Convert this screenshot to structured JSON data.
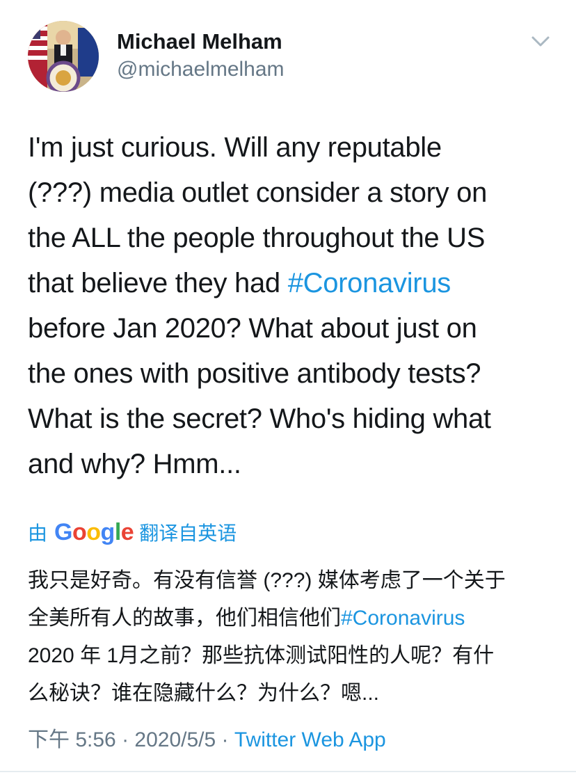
{
  "author": {
    "display_name": "Michael Melham",
    "handle": "@michaelmelham",
    "avatar_icon": "profile-photo-with-township-seal"
  },
  "menu": {
    "icon": "chevron-down-icon"
  },
  "tweet": {
    "lines": [
      {
        "text": "I'm just curious.  Will any reputable",
        "hashtag": ""
      },
      {
        "text": "(???) media outlet consider a story on",
        "hashtag": ""
      },
      {
        "text": "the ALL the people throughout the US",
        "hashtag": ""
      },
      {
        "text": "that believe they had ",
        "hashtag": "#Coronavirus"
      },
      {
        "text": "before Jan 2020? What about just on",
        "hashtag": ""
      },
      {
        "text": "the ones with positive antibody tests?",
        "hashtag": ""
      },
      {
        "text": "What is the secret? Who's hiding what",
        "hashtag": ""
      },
      {
        "text": "and why? Hmm...",
        "hashtag": ""
      }
    ]
  },
  "translation": {
    "prefix": "由",
    "google": [
      "G",
      "o",
      "o",
      "g",
      "l",
      "e"
    ],
    "suffix": "翻译自英语",
    "lines": [
      {
        "text": "我只是好奇。有没有信誉 (???) 媒体考虑了一个关于",
        "hashtag": ""
      },
      {
        "text": "全美所有人的故事，他们相信他们",
        "hashtag": "#Coronavirus"
      },
      {
        "text": "2020 年 1月之前？那些抗体测试阳性的人呢？有什",
        "hashtag": ""
      },
      {
        "text": "么秘诀？谁在隐藏什么？为什么？嗯...",
        "hashtag": ""
      }
    ]
  },
  "meta": {
    "time": "下午 5:56",
    "date": "2020/5/5",
    "separator": " · ",
    "app": "Twitter Web App"
  },
  "colors": {
    "link": "#1b95e0",
    "secondary": "#657786",
    "text": "#14171a"
  }
}
